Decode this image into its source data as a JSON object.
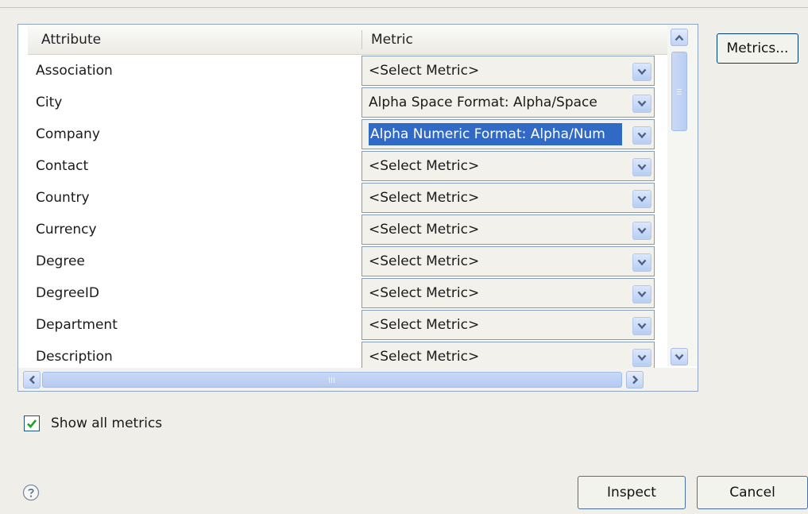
{
  "table": {
    "columns": {
      "attribute": "Attribute",
      "metric": "Metric"
    },
    "rows": [
      {
        "attribute": "Association",
        "metric": "<Select Metric>"
      },
      {
        "attribute": "City",
        "metric": "Alpha Space Format:  Alpha/Space"
      },
      {
        "attribute": "Company",
        "metric": "Alpha Numeric Format:  Alpha/Num",
        "selected": true
      },
      {
        "attribute": "Contact",
        "metric": "<Select Metric>"
      },
      {
        "attribute": "Country",
        "metric": "<Select Metric>"
      },
      {
        "attribute": "Currency",
        "metric": "<Select Metric>"
      },
      {
        "attribute": "Degree",
        "metric": "<Select Metric>"
      },
      {
        "attribute": "DegreeID",
        "metric": "<Select Metric>"
      },
      {
        "attribute": "Department",
        "metric": "<Select Metric>"
      },
      {
        "attribute": "Description",
        "metric": "<Select Metric>"
      }
    ]
  },
  "buttons": {
    "metrics": "Metrics...",
    "inspect": "Inspect",
    "cancel": "Cancel"
  },
  "show_all_metrics": {
    "label": "Show all metrics",
    "checked": true
  },
  "icons": {
    "dropdown": "chevron-down-icon",
    "help": "help-icon",
    "check": "checkmark-icon"
  },
  "colors": {
    "selection": "#316ac5",
    "button_border": "#003c74",
    "checkmark": "#21a121",
    "scroll_arrow": "#4d6185"
  }
}
